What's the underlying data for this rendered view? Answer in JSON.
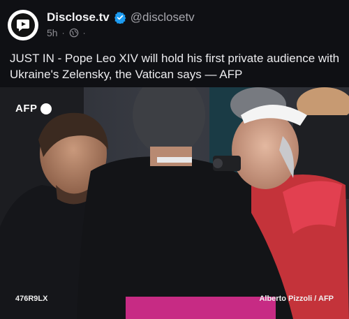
{
  "post": {
    "author_name": "Disclose.tv",
    "handle": "@disclosetv",
    "time": "5h",
    "separator": "·",
    "text": "JUST IN - Pope Leo XIV will hold his first private audience with Ukraine's Zelensky, the Vatican says — AFP"
  },
  "media": {
    "watermark": "AFP",
    "image_id": "476R9LX",
    "credit": "Alberto Pizzoli / AFP"
  },
  "icons": {
    "verified": "verified-badge-icon",
    "visibility": "globe-icon",
    "avatar": "disclose-tv-logo"
  },
  "colors": {
    "background": "#0f1014",
    "verified": "#1d9bf0",
    "text": "#ececef",
    "muted": "#8d8d93"
  }
}
